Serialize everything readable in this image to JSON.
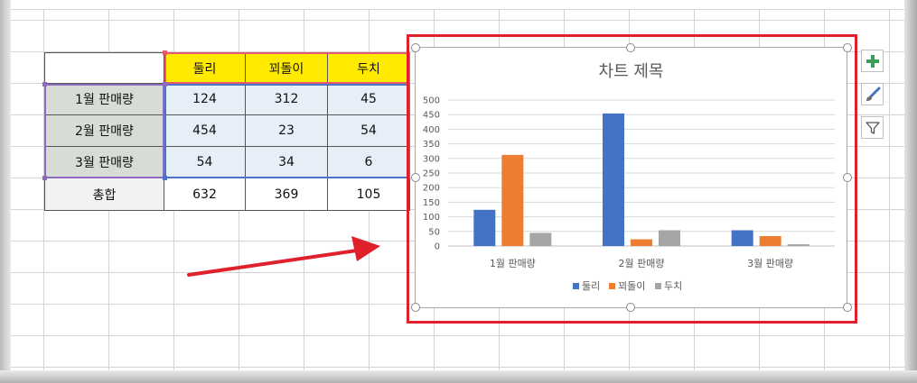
{
  "table": {
    "headers": [
      "둘리",
      "꾀돌이",
      "두치"
    ],
    "rows": [
      {
        "label": "1월 판매량",
        "values": [
          "124",
          "312",
          "45"
        ]
      },
      {
        "label": "2월 판매량",
        "values": [
          "454",
          "23",
          "54"
        ]
      },
      {
        "label": "3월 판매량",
        "values": [
          "54",
          "34",
          "6"
        ]
      }
    ],
    "total": {
      "label": "총합",
      "values": [
        "632",
        "369",
        "105"
      ]
    }
  },
  "chart_data": {
    "type": "bar",
    "title": "차트 제목",
    "categories": [
      "1월 판매량",
      "2월 판매량",
      "3월 판매량"
    ],
    "series": [
      {
        "name": "둘리",
        "values": [
          124,
          454,
          54
        ],
        "color": "#4472c4"
      },
      {
        "name": "꾀돌이",
        "values": [
          312,
          23,
          34
        ],
        "color": "#ed7d31"
      },
      {
        "name": "두치",
        "values": [
          45,
          54,
          6
        ],
        "color": "#a5a5a5"
      }
    ],
    "y_ticks": [
      "0",
      "50",
      "100",
      "150",
      "200",
      "250",
      "300",
      "350",
      "400",
      "450",
      "500"
    ],
    "ylim": [
      0,
      500
    ],
    "grid": true,
    "legend": "bottom"
  },
  "chart_tools": {
    "icons": [
      "chart-elements-icon",
      "chart-styles-icon",
      "chart-filters-icon"
    ]
  },
  "annotations": {
    "highlight_color": "#e0202a",
    "arrow_color": "#e0202a"
  }
}
